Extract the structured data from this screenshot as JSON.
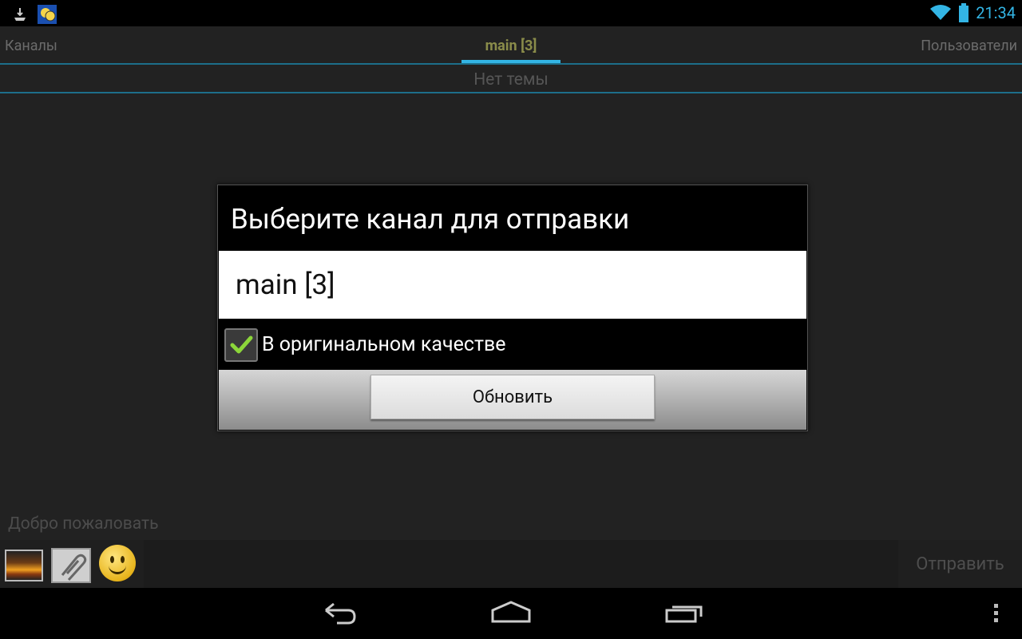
{
  "status": {
    "time": "21:34",
    "icons": [
      "download-icon",
      "app-notification-icon",
      "wifi-icon",
      "battery-icon"
    ]
  },
  "tabs": {
    "left": "Каналы",
    "center": "main [3]",
    "right": "Пользователи"
  },
  "topic": "Нет темы",
  "welcome_text": "Добро пожаловать",
  "input": {
    "placeholder": "",
    "send_label": "Отправить",
    "attach_icons": [
      "picture-icon",
      "paperclip-icon",
      "smiley-icon"
    ]
  },
  "dialog": {
    "title": "Выберите канал для отправки",
    "channel": "main [3]",
    "checkbox_label": "В оригинальном качестве",
    "checkbox_checked": true,
    "button_label": "Обновить"
  },
  "navbar": {
    "icons": [
      "back-icon",
      "home-icon",
      "recents-icon",
      "menu-icon"
    ]
  },
  "colors": {
    "accent": "#33b5e5",
    "active_tab": "#8a8c4a",
    "check": "#8cd63a"
  }
}
